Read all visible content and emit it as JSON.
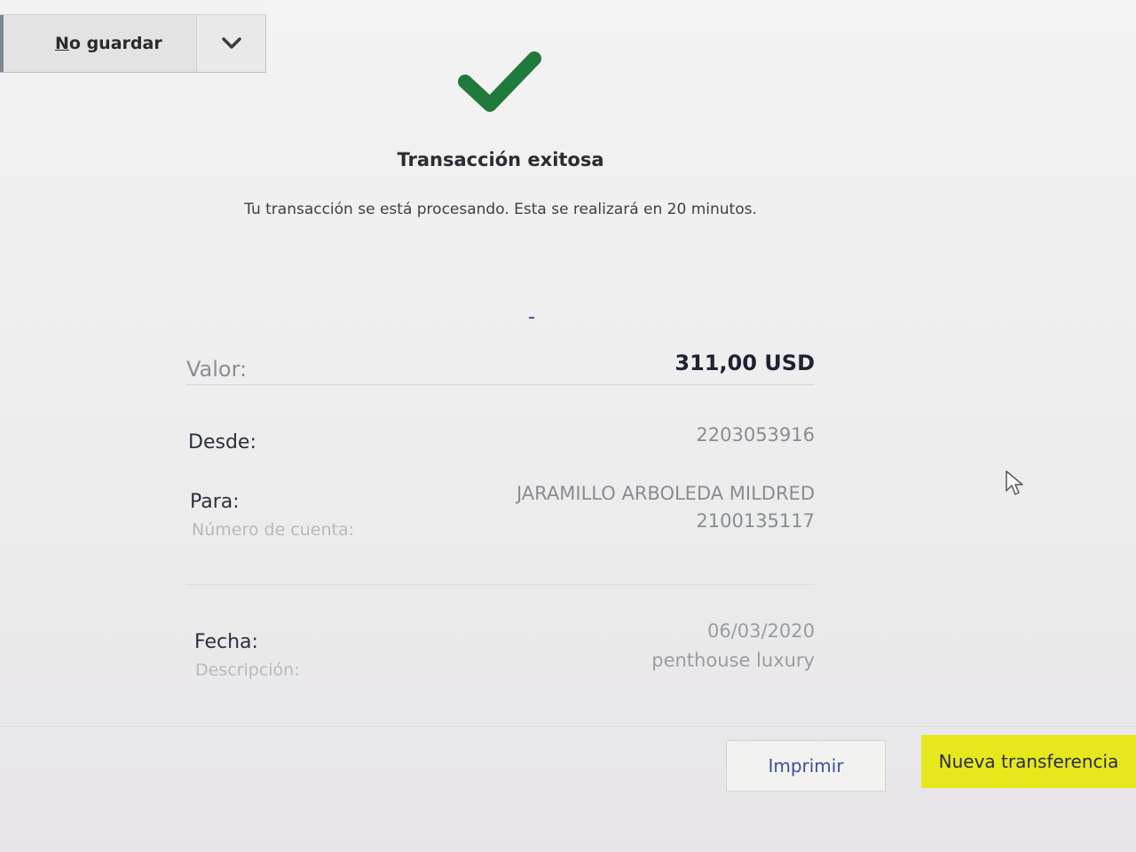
{
  "save_menu": {
    "label_first": "N",
    "label_rest": "o guardar"
  },
  "header": {
    "title": "Transacción exitosa",
    "message": "Tu transacción se está procesando. Esta se realizará en 20 minutos."
  },
  "details": {
    "valor_label": "Valor:",
    "valor_value": "311,00 USD",
    "desde_label": "Desde:",
    "desde_value": "2203053916",
    "para_label": "Para:",
    "para_name": "JARAMILLO ARBOLEDA MILDRED",
    "numero_label": "Número de cuenta:",
    "numero_value": "2100135117",
    "fecha_label": "Fecha:",
    "fecha_value": "06/03/2020",
    "descripcion_label": "Descripción:",
    "descripcion_value": "penthouse luxury"
  },
  "actions": {
    "print_label": "Imprimir",
    "new_transfer_label": "Nueva transferencia"
  },
  "colors": {
    "success_check": "#1f7a3c",
    "primary_button": "#e6e81c",
    "link_text": "#3c4fa0"
  },
  "icons": {
    "check": "check-icon",
    "chevron": "chevron-down-icon",
    "cursor": "mouse-cursor-icon"
  }
}
